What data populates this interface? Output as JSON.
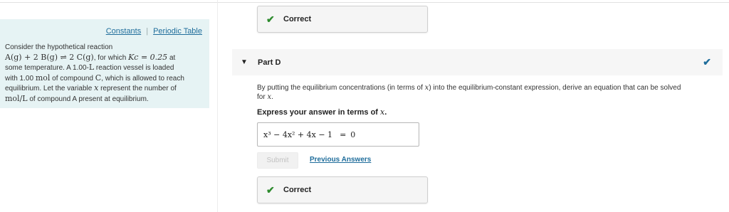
{
  "links": {
    "constants": "Constants",
    "separator": "|",
    "periodic_table": "Periodic Table"
  },
  "problem": {
    "line1": "Consider the hypothetical reaction",
    "reaction": "A(g) + 2 B(g) ⇌ 2 C(g)",
    "for_which": ", for which ",
    "kc": "Kc = 0.25",
    "at": " at",
    "line3a": "some temperature. A 1.00-",
    "unit_L": "L",
    "line3b": " reaction vessel is loaded",
    "line4a": "with 1.00 ",
    "unit_mol": "mol",
    "line4b": " of compound ",
    "compound_C": "C",
    "line4c": ", which is allowed to reach",
    "line5a": "equilibrium. Let the variable ",
    "var_x": "x",
    "line5b": " represent the number of",
    "unit_molL": "mol/L",
    "line6": " of compound A present at equilibrium."
  },
  "feedback_top": {
    "label": "Correct",
    "icon": "checkmark-icon"
  },
  "part": {
    "title": "Part D",
    "caret_icon": "caret-down-icon",
    "status_icon": "checkmark-icon"
  },
  "instructions": {
    "text_a": "By putting the equilibrium concentrations (in terms of ",
    "var": "x",
    "text_b": ") into the equilibrium-constant expression, derive an equation that can be solved",
    "text_c": "for ",
    "var2": "x",
    "text_d": "."
  },
  "express": {
    "text": "Express your answer in terms of ",
    "var": "x",
    "end": "."
  },
  "answer": {
    "expression": "x³ − 4x² + 4x − 1",
    "equals": "=",
    "rhs": "0"
  },
  "submit_label": "Submit",
  "previous_answers_label": "Previous Answers",
  "feedback_bottom": {
    "label": "Correct",
    "icon": "checkmark-icon"
  },
  "colors": {
    "info_panel_bg": "#e6f3f4",
    "link": "#1f6d9b",
    "correct_check": "#2e8b2e"
  }
}
